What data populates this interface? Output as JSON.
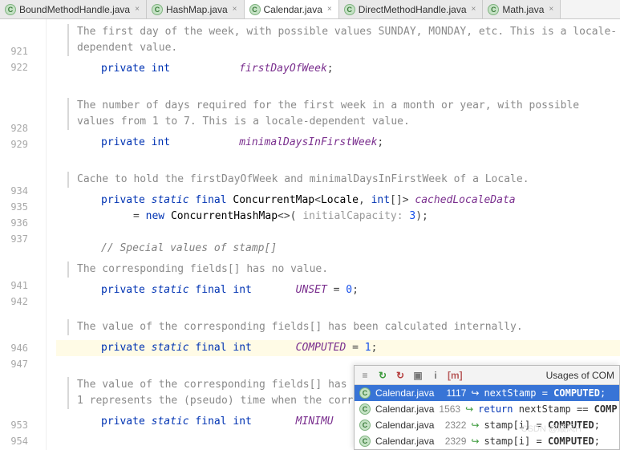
{
  "tabs": [
    {
      "label": "BoundMethodHandle.java",
      "active": false
    },
    {
      "label": "HashMap.java",
      "active": false
    },
    {
      "label": "Calendar.java",
      "active": true
    },
    {
      "label": "DirectMethodHandle.java",
      "active": false
    },
    {
      "label": "Math.java",
      "active": false
    }
  ],
  "gutter": [
    "921",
    "922",
    "928",
    "929",
    "934",
    "935",
    "936",
    "937",
    "941",
    "942",
    "946",
    "947",
    "953",
    "954"
  ],
  "docs": {
    "d1": "The first day of the week, with possible values SUNDAY, MONDAY, etc. This is a locale-dependent value.",
    "d2": "The number of days required for the first week in a month or year, with possible values from 1 to 7. This is a locale-dependent value.",
    "d3": "Cache to hold the firstDayOfWeek and minimalDaysInFirstWeek of a Locale.",
    "d4": "The corresponding fields[] has no value.",
    "d5": "The value of the corresponding fields[] has been calculated internally.",
    "d6a": "The value of the corresponding fields[] has been",
    "d6b": "1 represents the (pseudo) time when the corres"
  },
  "code": {
    "kw_private": "private",
    "kw_static": "static",
    "kw_final": "final",
    "kw_int": "int",
    "kw_new": "new",
    "kw_return": "return",
    "t_cmap": "ConcurrentMap",
    "t_locale": "Locale",
    "t_chm": "ConcurrentHashMap",
    "f_first": "firstDayOfWeek",
    "f_minimal": "minimalDaysInFirstWeek",
    "f_cached": "cachedLocaleData",
    "hint_cap": "initialCapacity:",
    "v3": "3",
    "comment_sp": "// Special values of stamp[]",
    "c_unset": "UNSET",
    "c_unset_v": "0",
    "c_computed": "COMPUTED",
    "c_computed_v": "1",
    "c_min": "MINIMU"
  },
  "popup": {
    "title": "Usages of COM",
    "icons": {
      "i1": "≡",
      "i2": "↻",
      "i3": "↻",
      "i4": "▣",
      "i5": "i",
      "i6": "[m]"
    },
    "rows": [
      {
        "file": "Calendar.java",
        "line": "1117",
        "snippet_pre": "nextStamp = ",
        "target": "COMPUTED",
        "post": ";",
        "sel": true
      },
      {
        "file": "Calendar.java",
        "line": "1563",
        "snippet_pre": "return ",
        "mid": "nextStamp == ",
        "target": "COMP",
        "post": "",
        "sel": false,
        "hasReturn": true
      },
      {
        "file": "Calendar.java",
        "line": "2322",
        "snippet_pre": "stamp[i] = ",
        "target": "COMPUTED",
        "post": ";",
        "sel": false
      },
      {
        "file": "Calendar.java",
        "line": "2329",
        "snippet_pre": "stamp[i] = ",
        "target": "COMPUTED",
        "post": ";",
        "sel": false
      }
    ]
  },
  "watermark": "CSDN @顺风H"
}
